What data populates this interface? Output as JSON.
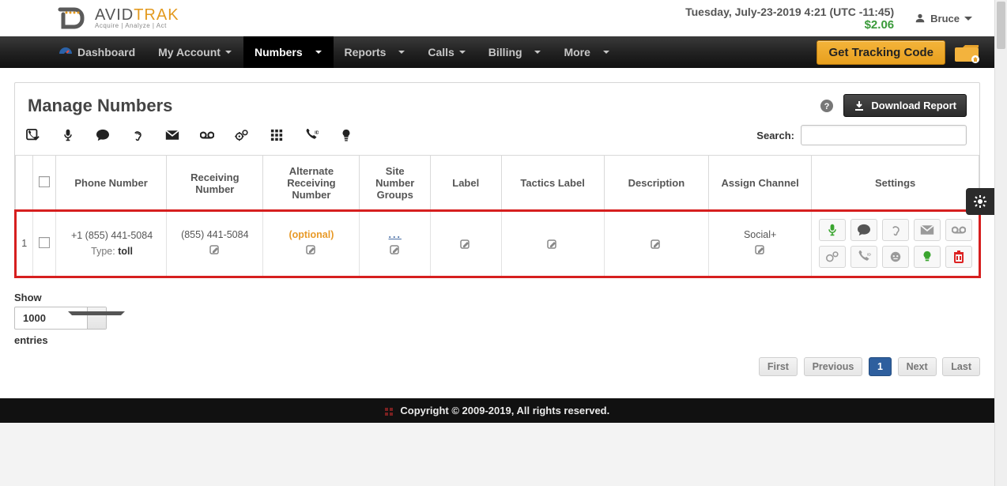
{
  "brand": {
    "name_left": "AVID",
    "name_right": "TRAK",
    "tagline": "Acquire | Analyze | Act"
  },
  "header": {
    "datetime": "Tuesday, July-23-2019 4:21 (UTC -11:45)",
    "credit": "$2.06",
    "username": "Bruce"
  },
  "nav": {
    "dashboard": "Dashboard",
    "my_account": "My Account",
    "numbers": "Numbers",
    "reports": "Reports",
    "calls": "Calls",
    "billing": "Billing",
    "more": "More",
    "get_code": "Get Tracking Code"
  },
  "page": {
    "title": "Manage Numbers",
    "download": "Download Report",
    "search_label": "Search:",
    "search_value": ""
  },
  "columns": {
    "phone_number": "Phone Number",
    "receiving_number": "Receiving Number",
    "alt_receiving_number": "Alternate Receiving Number",
    "site_groups": "Site Number Groups",
    "label": "Label",
    "tactics_label": "Tactics Label",
    "description": "Description",
    "assign_channel": "Assign Channel",
    "settings": "Settings"
  },
  "rows": [
    {
      "index": "1",
      "phone": "+1 (855) 441-5084",
      "type_label": "Type:",
      "type_value": "toll",
      "receiving": "(855) 441-5084",
      "alternate": "(optional)",
      "groups": "...",
      "channel": "Social+"
    }
  ],
  "pager": {
    "show": "Show",
    "entries": "entries",
    "page_size": "1000",
    "first": "First",
    "previous": "Previous",
    "current": "1",
    "next": "Next",
    "last": "Last"
  },
  "footer": {
    "text": "Copyright © 2009-2019, All rights reserved."
  }
}
